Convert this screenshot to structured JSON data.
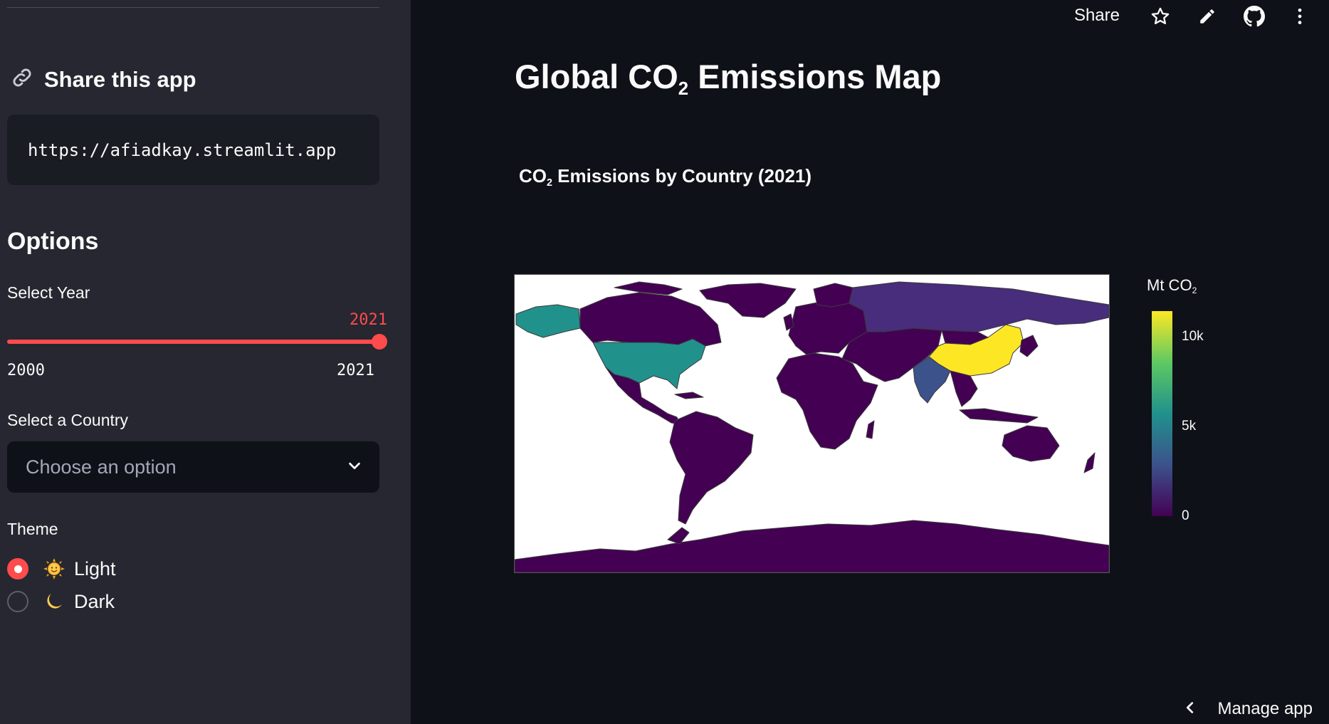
{
  "sidebar": {
    "share_heading": "Share this app",
    "share_url": "https://afiadkay.streamlit.app",
    "options_heading": "Options",
    "year_label": "Select Year",
    "slider": {
      "value": "2021",
      "min": "2000",
      "max": "2021",
      "fraction": 1.0
    },
    "country_label": "Select a Country",
    "country_placeholder": "Choose an option",
    "theme_label": "Theme",
    "theme_options": [
      {
        "label": "Light",
        "emoji": "sun-face-icon",
        "selected": true
      },
      {
        "label": "Dark",
        "emoji": "crescent-moon-icon",
        "selected": false
      }
    ]
  },
  "topbar": {
    "share_label": "Share",
    "icons": [
      "star-icon",
      "pencil-icon",
      "github-icon",
      "more-vertical-icon"
    ]
  },
  "main": {
    "title_pre": "Global CO",
    "title_sub": "2",
    "title_post": " Emissions Map",
    "chart_title_pre": "CO",
    "chart_title_sub": "2",
    "chart_title_post": " Emissions by Country (2021)"
  },
  "chart_data": {
    "type": "choropleth",
    "colorbar_title_pre": "Mt CO",
    "colorbar_title_sub": "2",
    "colorbar_ticks": [
      "10k",
      "5k",
      "0"
    ],
    "colorscale": "viridis",
    "range": [
      0,
      11500
    ],
    "highlighted": [
      {
        "country": "China",
        "value": 11500,
        "color": "#fde725"
      },
      {
        "country": "United States",
        "value": 5000,
        "color": "#21918c"
      },
      {
        "country": "India",
        "value": 2700,
        "color": "#3b528b"
      },
      {
        "country": "Russia",
        "value": 1800,
        "color": "#472d7b"
      }
    ],
    "other_color": "#440154"
  },
  "footer": {
    "manage_label": "Manage app"
  },
  "colors": {
    "accent": "#ff4b4b",
    "sidebar_bg": "#262730",
    "main_bg": "#0e1117"
  }
}
